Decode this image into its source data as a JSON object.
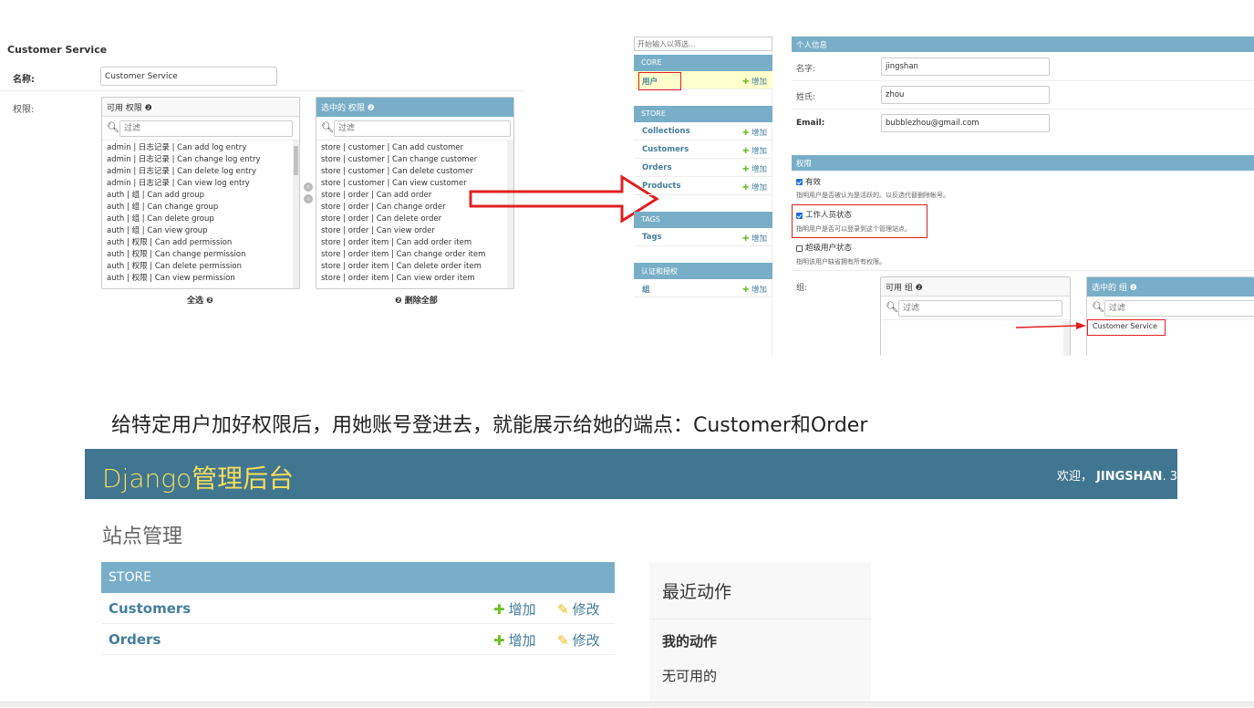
{
  "group_form": {
    "title": "Customer Service",
    "name_label": "名称:",
    "name_value": "Customer Service",
    "perm_label": "权限:",
    "available": {
      "header": "可用 权限 ❷",
      "filter_placeholder": "过滤",
      "items": [
        "admin | 日志记录 | Can add log entry",
        "admin | 日志记录 | Can change log entry",
        "admin | 日志记录 | Can delete log entry",
        "admin | 日志记录 | Can view log entry",
        "auth | 组 | Can add group",
        "auth | 组 | Can change group",
        "auth | 组 | Can delete group",
        "auth | 组 | Can view group",
        "auth | 权限 | Can add permission",
        "auth | 权限 | Can change permission",
        "auth | 权限 | Can delete permission",
        "auth | 权限 | Can view permission"
      ]
    },
    "chosen": {
      "header": "选中的 权限 ❷",
      "filter_placeholder": "过滤",
      "items": [
        "store | customer | Can add customer",
        "store | customer | Can change customer",
        "store | customer | Can delete customer",
        "store | customer | Can view customer",
        "store | order | Can add order",
        "store | order | Can change order",
        "store | order | Can delete order",
        "store | order | Can view order",
        "store | order item | Can add order item",
        "store | order item | Can change order item",
        "store | order item | Can delete order item",
        "store | order item | Can view order item"
      ]
    },
    "choose_all": "全选 ❷",
    "remove_all": "❷ 删除全部"
  },
  "sidebar": {
    "filter_placeholder": "开始输入以筛选...",
    "add_label": "增加",
    "sections": [
      {
        "header": "CORE",
        "items": [
          "用户"
        ]
      },
      {
        "header": "STORE",
        "items": [
          "Collections",
          "Customers",
          "Orders",
          "Products"
        ]
      },
      {
        "header": "TAGS",
        "items": [
          "Tags"
        ]
      },
      {
        "header": "认证和授权",
        "items": [
          "组"
        ]
      }
    ]
  },
  "user_form": {
    "personal_header": "个人信息",
    "first_name_label": "名字:",
    "first_name_value": "jingshan",
    "last_name_label": "姓氏:",
    "last_name_value": "zhou",
    "email_label": "Email:",
    "email_value": "bubblezhou@gmail.com",
    "perm_header": "权限",
    "active_label": "有效",
    "active_help": "指明用户是否被认为是活跃的。以反选代替删除帐号。",
    "staff_label": "工作人员状态",
    "staff_help": "指明用户是否可以登录到这个管理站点。",
    "super_label": "超级用户状态",
    "super_help": "指明该用户缺省拥有所有权限。",
    "groups_label": "组:",
    "groups_available_header": "可用 组 ❷",
    "groups_chosen_header": "选中的 组 ❷",
    "groups_filter_placeholder": "过滤",
    "groups_chosen_items": [
      "Customer Service"
    ]
  },
  "caption": "给特定用户加好权限后，用她账号登进去，就能展示给她的端点：Customer和Order",
  "django_home": {
    "brand": "Django管理后台",
    "welcome": "欢迎，",
    "username": "JINGSHAN",
    "user_trail": ". 3",
    "site_title": "站点管理",
    "module_header": "STORE",
    "add_label": "增加",
    "change_label": "修改",
    "models": [
      "Customers",
      "Orders"
    ],
    "recent_title": "最近动作",
    "my_actions": "我的动作",
    "none_available": "无可用的"
  },
  "colors": {
    "header_bg": "#417690",
    "module_bg": "#79aec8",
    "brand_yellow": "#f5dd5d",
    "link": "#447e9b",
    "annotation_red": "#e02020"
  }
}
